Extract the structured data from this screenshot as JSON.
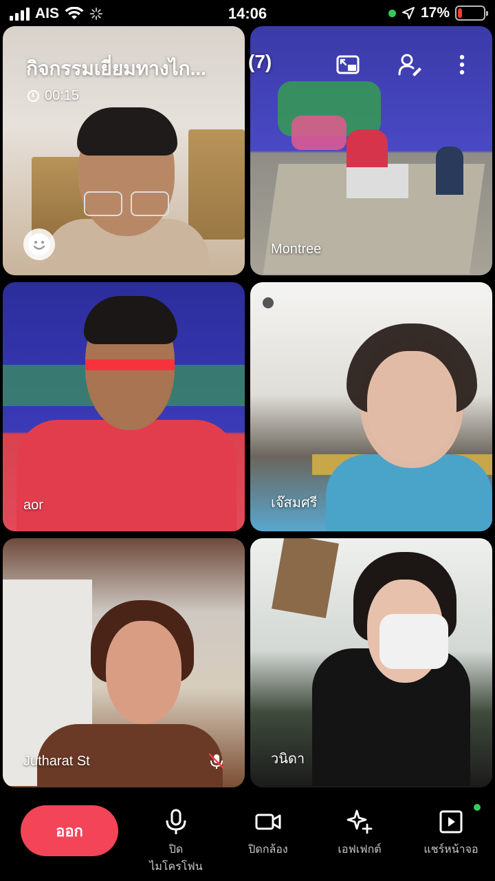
{
  "status_bar": {
    "carrier": "AIS",
    "time": "14:06",
    "battery": "17%",
    "battery_level": 0.17,
    "battery_color": "#ff3b30",
    "location_icon": "location-arrow-icon"
  },
  "meeting": {
    "title": "กิจกรรมเยี่ยมทางไก...",
    "timer": "00:15",
    "participant_count": "(7)"
  },
  "participants": [
    {
      "name": ""
    },
    {
      "name": "Montree"
    },
    {
      "name": "aor"
    },
    {
      "name": "เจ๊สมศรี"
    },
    {
      "name": "Jutharat St",
      "muted": true
    },
    {
      "name": "วนิดา"
    }
  ],
  "controls": {
    "leave": "ออก",
    "mic_line1": "ปิด",
    "mic_line2": "ไมโครโฟน",
    "camera": "ปิดกล้อง",
    "effects": "เอฟเฟกต์",
    "share": "แชร์หน้าจอ"
  },
  "colors": {
    "leave_button": "#f44458",
    "notification_dot": "#36c95a"
  }
}
